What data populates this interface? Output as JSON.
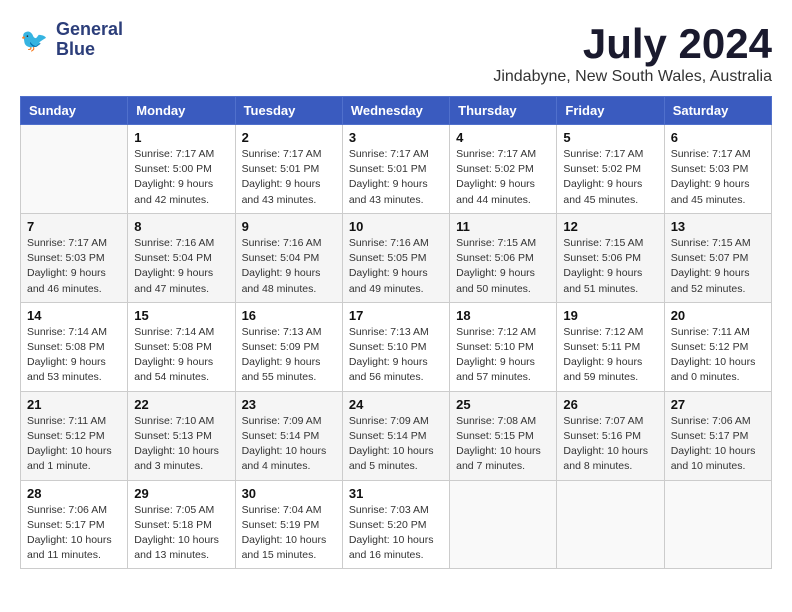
{
  "logo": {
    "line1": "General",
    "line2": "Blue"
  },
  "title": "July 2024",
  "location": "Jindabyne, New South Wales, Australia",
  "days_of_week": [
    "Sunday",
    "Monday",
    "Tuesday",
    "Wednesday",
    "Thursday",
    "Friday",
    "Saturday"
  ],
  "weeks": [
    [
      {
        "day": "",
        "info": ""
      },
      {
        "day": "1",
        "info": "Sunrise: 7:17 AM\nSunset: 5:00 PM\nDaylight: 9 hours\nand 42 minutes."
      },
      {
        "day": "2",
        "info": "Sunrise: 7:17 AM\nSunset: 5:01 PM\nDaylight: 9 hours\nand 43 minutes."
      },
      {
        "day": "3",
        "info": "Sunrise: 7:17 AM\nSunset: 5:01 PM\nDaylight: 9 hours\nand 43 minutes."
      },
      {
        "day": "4",
        "info": "Sunrise: 7:17 AM\nSunset: 5:02 PM\nDaylight: 9 hours\nand 44 minutes."
      },
      {
        "day": "5",
        "info": "Sunrise: 7:17 AM\nSunset: 5:02 PM\nDaylight: 9 hours\nand 45 minutes."
      },
      {
        "day": "6",
        "info": "Sunrise: 7:17 AM\nSunset: 5:03 PM\nDaylight: 9 hours\nand 45 minutes."
      }
    ],
    [
      {
        "day": "7",
        "info": "Sunrise: 7:17 AM\nSunset: 5:03 PM\nDaylight: 9 hours\nand 46 minutes."
      },
      {
        "day": "8",
        "info": "Sunrise: 7:16 AM\nSunset: 5:04 PM\nDaylight: 9 hours\nand 47 minutes."
      },
      {
        "day": "9",
        "info": "Sunrise: 7:16 AM\nSunset: 5:04 PM\nDaylight: 9 hours\nand 48 minutes."
      },
      {
        "day": "10",
        "info": "Sunrise: 7:16 AM\nSunset: 5:05 PM\nDaylight: 9 hours\nand 49 minutes."
      },
      {
        "day": "11",
        "info": "Sunrise: 7:15 AM\nSunset: 5:06 PM\nDaylight: 9 hours\nand 50 minutes."
      },
      {
        "day": "12",
        "info": "Sunrise: 7:15 AM\nSunset: 5:06 PM\nDaylight: 9 hours\nand 51 minutes."
      },
      {
        "day": "13",
        "info": "Sunrise: 7:15 AM\nSunset: 5:07 PM\nDaylight: 9 hours\nand 52 minutes."
      }
    ],
    [
      {
        "day": "14",
        "info": "Sunrise: 7:14 AM\nSunset: 5:08 PM\nDaylight: 9 hours\nand 53 minutes."
      },
      {
        "day": "15",
        "info": "Sunrise: 7:14 AM\nSunset: 5:08 PM\nDaylight: 9 hours\nand 54 minutes."
      },
      {
        "day": "16",
        "info": "Sunrise: 7:13 AM\nSunset: 5:09 PM\nDaylight: 9 hours\nand 55 minutes."
      },
      {
        "day": "17",
        "info": "Sunrise: 7:13 AM\nSunset: 5:10 PM\nDaylight: 9 hours\nand 56 minutes."
      },
      {
        "day": "18",
        "info": "Sunrise: 7:12 AM\nSunset: 5:10 PM\nDaylight: 9 hours\nand 57 minutes."
      },
      {
        "day": "19",
        "info": "Sunrise: 7:12 AM\nSunset: 5:11 PM\nDaylight: 9 hours\nand 59 minutes."
      },
      {
        "day": "20",
        "info": "Sunrise: 7:11 AM\nSunset: 5:12 PM\nDaylight: 10 hours\nand 0 minutes."
      }
    ],
    [
      {
        "day": "21",
        "info": "Sunrise: 7:11 AM\nSunset: 5:12 PM\nDaylight: 10 hours\nand 1 minute."
      },
      {
        "day": "22",
        "info": "Sunrise: 7:10 AM\nSunset: 5:13 PM\nDaylight: 10 hours\nand 3 minutes."
      },
      {
        "day": "23",
        "info": "Sunrise: 7:09 AM\nSunset: 5:14 PM\nDaylight: 10 hours\nand 4 minutes."
      },
      {
        "day": "24",
        "info": "Sunrise: 7:09 AM\nSunset: 5:14 PM\nDaylight: 10 hours\nand 5 minutes."
      },
      {
        "day": "25",
        "info": "Sunrise: 7:08 AM\nSunset: 5:15 PM\nDaylight: 10 hours\nand 7 minutes."
      },
      {
        "day": "26",
        "info": "Sunrise: 7:07 AM\nSunset: 5:16 PM\nDaylight: 10 hours\nand 8 minutes."
      },
      {
        "day": "27",
        "info": "Sunrise: 7:06 AM\nSunset: 5:17 PM\nDaylight: 10 hours\nand 10 minutes."
      }
    ],
    [
      {
        "day": "28",
        "info": "Sunrise: 7:06 AM\nSunset: 5:17 PM\nDaylight: 10 hours\nand 11 minutes."
      },
      {
        "day": "29",
        "info": "Sunrise: 7:05 AM\nSunset: 5:18 PM\nDaylight: 10 hours\nand 13 minutes."
      },
      {
        "day": "30",
        "info": "Sunrise: 7:04 AM\nSunset: 5:19 PM\nDaylight: 10 hours\nand 15 minutes."
      },
      {
        "day": "31",
        "info": "Sunrise: 7:03 AM\nSunset: 5:20 PM\nDaylight: 10 hours\nand 16 minutes."
      },
      {
        "day": "",
        "info": ""
      },
      {
        "day": "",
        "info": ""
      },
      {
        "day": "",
        "info": ""
      }
    ]
  ]
}
